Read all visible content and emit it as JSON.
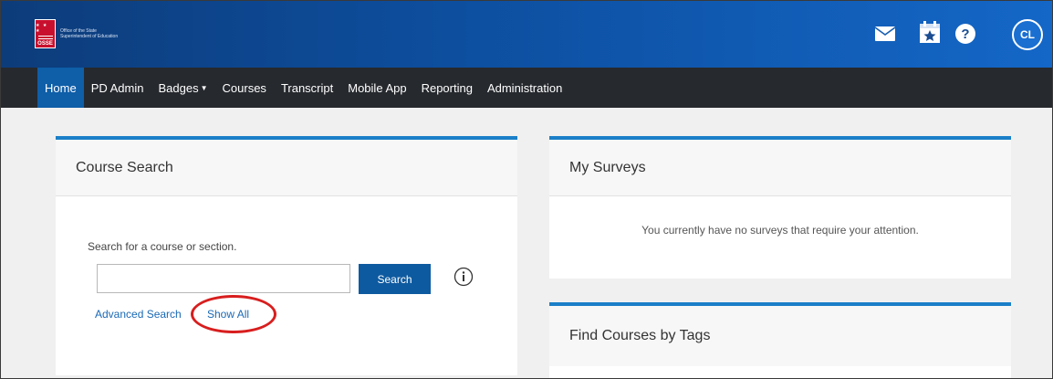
{
  "header": {
    "logo_abbrev": "OSSE",
    "logo_text": "Office of the State Superintendent of Education",
    "avatar_initials": "CL",
    "icons": [
      "mail-icon",
      "calendar-star-icon",
      "help-icon"
    ]
  },
  "nav": {
    "items": [
      {
        "label": "Home",
        "active": true
      },
      {
        "label": "PD Admin"
      },
      {
        "label": "Badges",
        "dropdown": true
      },
      {
        "label": "Courses"
      },
      {
        "label": "Transcript"
      },
      {
        "label": "Mobile App"
      },
      {
        "label": "Reporting"
      },
      {
        "label": "Administration"
      }
    ]
  },
  "course_search": {
    "title": "Course Search",
    "prompt": "Search for a course or section.",
    "input_value": "",
    "search_button": "Search",
    "advanced_link": "Advanced Search",
    "show_all_link": "Show All"
  },
  "my_surveys": {
    "title": "My Surveys",
    "empty_message": "You currently have no surveys that require your attention."
  },
  "find_courses": {
    "title": "Find Courses by Tags"
  },
  "colors": {
    "accent": "#1b7fc8",
    "nav_bg": "#26292e",
    "nav_active": "#0e5ea8",
    "button": "#0e5aa0",
    "annotation": "#d81e1e",
    "link": "#1a69b5"
  }
}
